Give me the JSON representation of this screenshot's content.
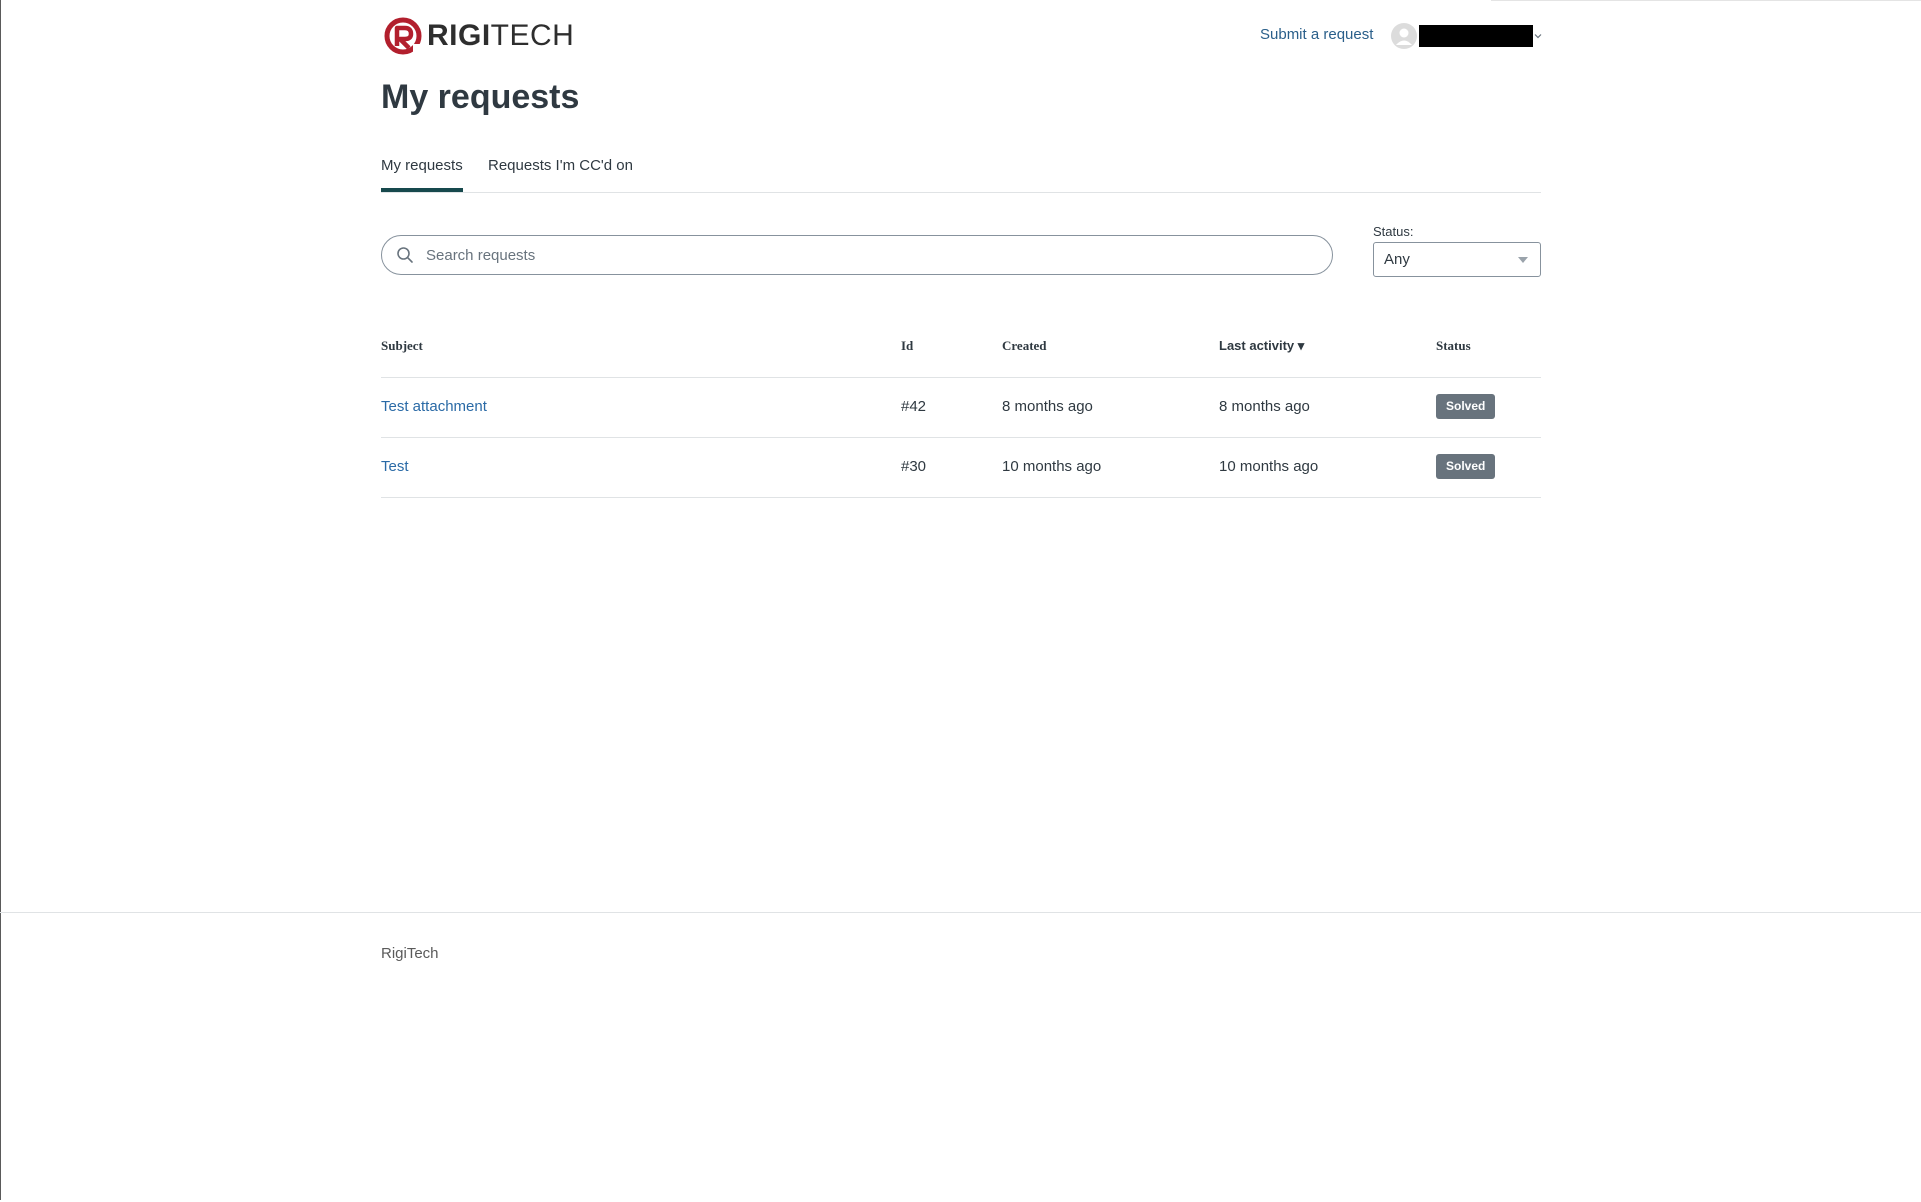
{
  "brand": {
    "logo_bold": "RIGI",
    "logo_light": "TECH",
    "accent_color": "#b21f2d"
  },
  "header": {
    "submit_label": "Submit a request",
    "user_icon": "user-avatar-icon",
    "user_menu_icon": "chevron-down-icon"
  },
  "page": {
    "title": "My requests"
  },
  "tabs": [
    {
      "label": "My requests",
      "active": true
    },
    {
      "label": "Requests I'm CC'd on",
      "active": false
    }
  ],
  "search": {
    "placeholder": "Search requests",
    "value": "",
    "icon": "search-icon"
  },
  "filter": {
    "status_label": "Status:",
    "status_value": "Any"
  },
  "table": {
    "headers": {
      "subject": "Subject",
      "id": "Id",
      "created": "Created",
      "last_activity": "Last activity ▾",
      "status": "Status"
    },
    "rows": [
      {
        "subject": "Test attachment",
        "id": "#42",
        "created": "8 months ago",
        "last_activity": "8 months ago",
        "status": "Solved"
      },
      {
        "subject": "Test",
        "id": "#30",
        "created": "10 months ago",
        "last_activity": "10 months ago",
        "status": "Solved"
      }
    ]
  },
  "footer": {
    "text": "RigiTech"
  }
}
